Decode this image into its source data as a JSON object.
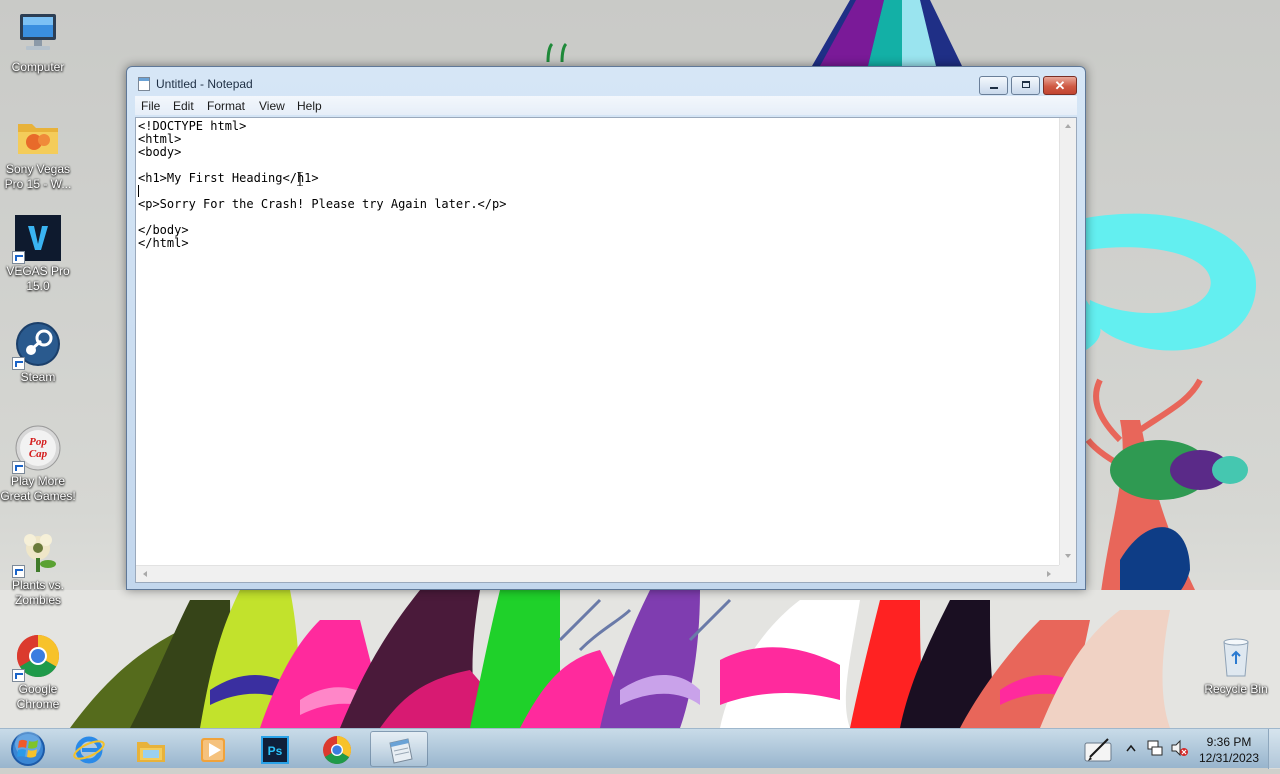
{
  "desktop": {
    "icons": [
      {
        "label": "Computer"
      },
      {
        "label": "Sony Vegas Pro 15 - W..."
      },
      {
        "label": "VEGAS Pro 15.0"
      },
      {
        "label": "Steam"
      },
      {
        "label": "Play More Great Games!",
        "logo_text": "PopCap"
      },
      {
        "label": "Plants vs. Zombies"
      },
      {
        "label": "Google Chrome"
      }
    ],
    "recycle_bin": {
      "label": "Recycle Bin"
    }
  },
  "notepad": {
    "title": "Untitled - Notepad",
    "menu": [
      "File",
      "Edit",
      "Format",
      "View",
      "Help"
    ],
    "content": "<!DOCTYPE html>\n<html>\n<body>\n\n<h1>My First Heading</h1>\n\n<p>Sorry For the Crash! Please try Again later.</p>\n\n</body>\n</html>"
  },
  "taskbar": {
    "apps": [
      "internet-explorer",
      "windows-explorer",
      "windows-media-player",
      "photoshop",
      "google-chrome",
      "notepad"
    ],
    "active_app": "notepad",
    "clock": {
      "time": "9:36 PM",
      "date": "12/31/2023"
    }
  },
  "colors": {
    "accent": "#1a64c8",
    "close_button": "#c14430"
  }
}
